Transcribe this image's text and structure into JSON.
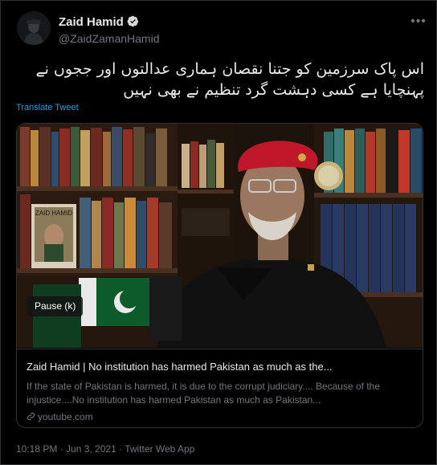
{
  "author": {
    "name": "Zaid Hamid",
    "handle": "@ZaidZamanHamid"
  },
  "tweet": {
    "text": "اس پاک سرزمین کو جتنا نقصان ہماری عدالتوں اور ججوں نے پہنچایا ہے کسی دہشت گرد تنظیم نے بھی نہیں",
    "translate_label": "Translate Tweet"
  },
  "media": {
    "pause_label": "Pause (k)",
    "book_cover_text": "ZAID HAMID"
  },
  "link_card": {
    "title": "Zaid Hamid | No institution has harmed Pakistan as much as the...",
    "description": "If the state of Pakistan is harmed, it is due to the corrupt judiciary.... Because of the injustice....No institution has harmed Pakistan as much as Pakistan...",
    "domain": "youtube.com"
  },
  "meta": {
    "timestamp": "10:18 PM · Jun 3, 2021 · Twitter Web App"
  },
  "icons": {
    "verified": "verified-badge-icon",
    "more": "more-options-icon",
    "link": "link-icon"
  },
  "colors": {
    "background": "#000000",
    "link_blue": "#1da1f2",
    "text_primary": "#e7e9ea",
    "text_secondary": "#71767b",
    "border": "#2f3336"
  }
}
